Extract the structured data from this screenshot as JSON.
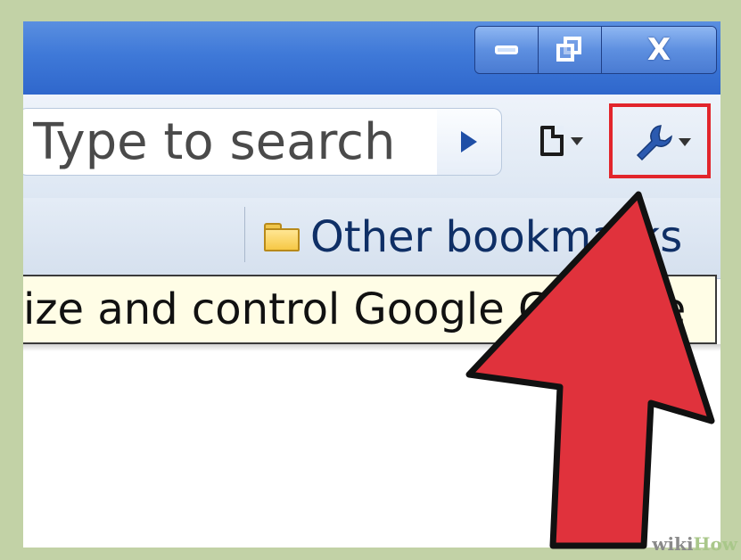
{
  "window": {
    "controls": {
      "minimize_icon": "minimize-icon",
      "restore_icon": "restore-icon",
      "close_glyph": "X"
    }
  },
  "toolbar": {
    "search_placeholder": "Type to search",
    "go_icon": "play-arrow-icon",
    "page_menu_icon": "page-icon",
    "wrench_menu_icon": "wrench-icon",
    "highlight_color": "#e2252b"
  },
  "bookmarks_bar": {
    "items": [
      {
        "label": "Other bookmarks",
        "icon": "folder-icon"
      }
    ]
  },
  "tooltip": {
    "text": "ize and control Google Chrome"
  },
  "annotation": {
    "arrow_color": "#e0323c"
  },
  "watermark": {
    "brand_part1": "wiki",
    "brand_part2": "How"
  }
}
